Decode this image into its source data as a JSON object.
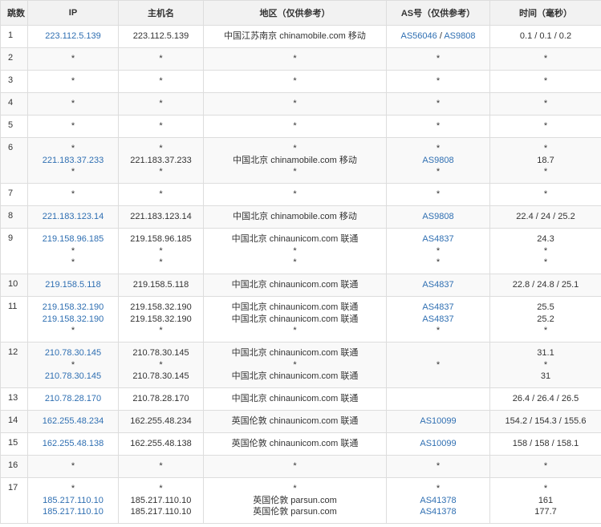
{
  "headers": [
    "跳数",
    "IP",
    "主机名",
    "地区（仅供参考）",
    "AS号（仅供参考）",
    "时间（毫秒）"
  ],
  "hops": [
    {
      "hop": "1",
      "h": 28,
      "ip": [
        "223.112.5.139"
      ],
      "host": [
        "223.112.5.139"
      ],
      "geo": [
        "中国江苏南京 chinamobile.com 移动"
      ],
      "asn": [
        [
          "AS56046",
          "AS9808"
        ]
      ],
      "time": [
        "0.1 / 0.1 / 0.2"
      ]
    },
    {
      "hop": "2",
      "h": 28,
      "ip": [
        "*"
      ],
      "host": [
        "*"
      ],
      "geo": [
        "*"
      ],
      "asn": [
        [
          "*"
        ]
      ],
      "time": [
        "*"
      ]
    },
    {
      "hop": "3",
      "h": 28,
      "ip": [
        "*"
      ],
      "host": [
        "*"
      ],
      "geo": [
        "*"
      ],
      "asn": [
        [
          "*"
        ]
      ],
      "time": [
        "*"
      ]
    },
    {
      "hop": "4",
      "h": 28,
      "ip": [
        "*"
      ],
      "host": [
        "*"
      ],
      "geo": [
        "*"
      ],
      "asn": [
        [
          "*"
        ]
      ],
      "time": [
        "*"
      ]
    },
    {
      "hop": "5",
      "h": 28,
      "ip": [
        "*"
      ],
      "host": [
        "*"
      ],
      "geo": [
        "*"
      ],
      "asn": [
        [
          "*"
        ]
      ],
      "time": [
        "*"
      ]
    },
    {
      "hop": "6",
      "h": 57,
      "ip": [
        "*",
        "221.183.37.233",
        "*"
      ],
      "host": [
        "*",
        "221.183.37.233",
        "*"
      ],
      "geo": [
        "*",
        "中国北京 chinamobile.com 移动",
        "*"
      ],
      "asn": [
        [
          "*"
        ],
        [
          "AS9808"
        ],
        [
          "*"
        ]
      ],
      "time": [
        "*",
        "18.7",
        "*"
      ]
    },
    {
      "hop": "7",
      "h": 28,
      "ip": [
        "*"
      ],
      "host": [
        "*"
      ],
      "geo": [
        "*"
      ],
      "asn": [
        [
          "*"
        ]
      ],
      "time": [
        "*"
      ]
    },
    {
      "hop": "8",
      "h": 28,
      "ip": [
        "221.183.123.14"
      ],
      "host": [
        "221.183.123.14"
      ],
      "geo": [
        "中国北京 chinamobile.com 移动"
      ],
      "asn": [
        [
          "AS9808"
        ]
      ],
      "time": [
        "22.4 / 24 / 25.2"
      ]
    },
    {
      "hop": "9",
      "h": 57,
      "ip": [
        "219.158.96.185",
        "*",
        "*"
      ],
      "host": [
        "219.158.96.185",
        "*",
        "*"
      ],
      "geo": [
        "中国北京 chinaunicom.com 联通",
        "*",
        "*"
      ],
      "asn": [
        [
          "AS4837"
        ],
        [
          "*"
        ],
        [
          "*"
        ]
      ],
      "time": [
        "24.3",
        "*",
        "*"
      ]
    },
    {
      "hop": "10",
      "h": 28,
      "ip": [
        "219.158.5.118"
      ],
      "host": [
        "219.158.5.118"
      ],
      "geo": [
        "中国北京 chinaunicom.com 联通"
      ],
      "asn": [
        [
          "AS4837"
        ]
      ],
      "time": [
        "22.8 / 24.8 / 25.1"
      ]
    },
    {
      "hop": "11",
      "h": 57,
      "ip": [
        "219.158.32.190",
        "219.158.32.190",
        "*"
      ],
      "host": [
        "219.158.32.190",
        "219.158.32.190",
        "*"
      ],
      "geo": [
        "中国北京 chinaunicom.com 联通",
        "中国北京 chinaunicom.com 联通",
        "*"
      ],
      "asn": [
        [
          "AS4837"
        ],
        [
          "AS4837"
        ],
        [
          "*"
        ]
      ],
      "time": [
        "25.5",
        "25.2",
        "*"
      ]
    },
    {
      "hop": "12",
      "h": 57,
      "ip": [
        "210.78.30.145",
        "*",
        "210.78.30.145"
      ],
      "host": [
        "210.78.30.145",
        "*",
        "210.78.30.145"
      ],
      "geo": [
        "中国北京 chinaunicom.com 联通",
        "*",
        "中国北京 chinaunicom.com 联通"
      ],
      "asn": [
        [
          "*"
        ]
      ],
      "time": [
        "31.1",
        "*",
        "31"
      ]
    },
    {
      "hop": "13",
      "h": 28,
      "ip": [
        "210.78.28.170"
      ],
      "host": [
        "210.78.28.170"
      ],
      "geo": [
        "中国北京 chinaunicom.com 联通"
      ],
      "asn": [
        []
      ],
      "time": [
        "26.4 / 26.4 / 26.5"
      ]
    },
    {
      "hop": "14",
      "h": 28,
      "ip": [
        "162.255.48.234"
      ],
      "host": [
        "162.255.48.234"
      ],
      "geo": [
        "英国伦敦 chinaunicom.com 联通"
      ],
      "asn": [
        [
          "AS10099"
        ]
      ],
      "time": [
        "154.2 / 154.3 / 155.6"
      ]
    },
    {
      "hop": "15",
      "h": 28,
      "ip": [
        "162.255.48.138"
      ],
      "host": [
        "162.255.48.138"
      ],
      "geo": [
        "英国伦敦 chinaunicom.com 联通"
      ],
      "asn": [
        [
          "AS10099"
        ]
      ],
      "time": [
        "158 / 158 / 158.1"
      ]
    },
    {
      "hop": "16",
      "h": 28,
      "ip": [
        "*"
      ],
      "host": [
        "*"
      ],
      "geo": [
        "*"
      ],
      "asn": [
        [
          "*"
        ]
      ],
      "time": [
        "*"
      ]
    },
    {
      "hop": "17",
      "h": 57,
      "ip": [
        "*",
        "185.217.110.10",
        "185.217.110.10"
      ],
      "host": [
        "*",
        "185.217.110.10",
        "185.217.110.10"
      ],
      "geo": [
        "*",
        "英国伦敦 parsun.com",
        "英国伦敦 parsun.com"
      ],
      "asn": [
        [
          "*"
        ],
        [
          "AS41378"
        ],
        [
          "AS41378"
        ]
      ],
      "time": [
        "*",
        "161",
        "177.7"
      ]
    }
  ]
}
